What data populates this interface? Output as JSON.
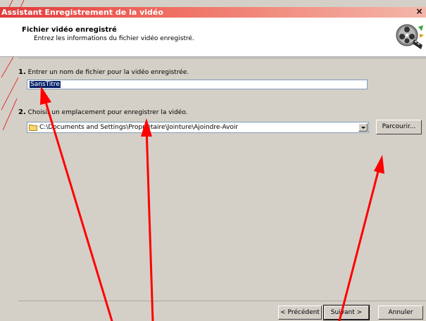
{
  "window": {
    "title": "Assistant Enregistrement de la vidéo",
    "close_glyph": "×"
  },
  "header": {
    "title": "Fichier vidéo enregistré",
    "subtitle": "Entrez les informations du fichier vidéo enregistré.",
    "icon": "film-reel-icon"
  },
  "step1": {
    "number": "1.",
    "label": "Entrer un nom de fichier pour la vidéo enregistrée.",
    "value": "SansTitre"
  },
  "step2": {
    "number": "2.",
    "label": "Choisir un emplacement pour enregistrer la vidéo.",
    "path": "C:\\Documents and Settings\\Propriétaire\\Jointure\\Ajoindre-Avoir",
    "browse_label": "Parcourir..."
  },
  "buttons": {
    "back": "< Précédent",
    "next": "Suivant >",
    "cancel": "Annuler"
  },
  "colors": {
    "annotation_arrow": "#ff0000",
    "title_gradient_start": "#e03a3a",
    "dialog_face": "#d4d0c8"
  }
}
